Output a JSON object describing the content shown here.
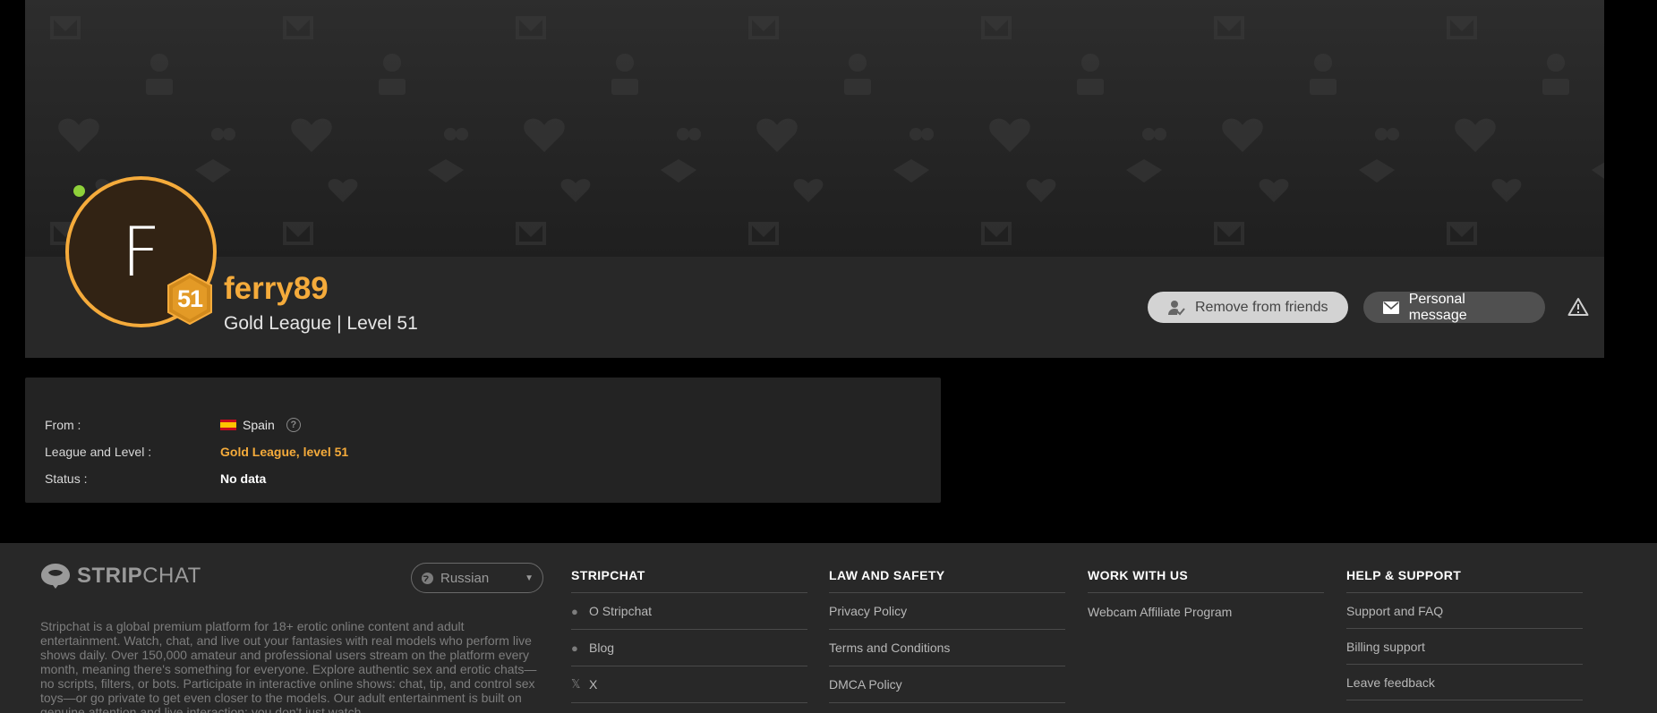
{
  "profile": {
    "avatar_letter": "F",
    "level": "51",
    "username": "ferry89",
    "league_line": "Gold League | Level 51",
    "online": true,
    "remove_friend_label": "Remove from friends",
    "message_label": "Personal message"
  },
  "info": {
    "rows": [
      {
        "label": "From :",
        "value": "Spain"
      },
      {
        "label": "League and Level :",
        "value": "Gold League, level 51"
      },
      {
        "label": "Status :",
        "value": "No data"
      }
    ]
  },
  "footer": {
    "logo_bold": "STRIP",
    "logo_light": "CHAT",
    "language": "Russian",
    "description": "Stripchat is a global premium platform for 18+ erotic online content and adult entertainment. Watch, chat, and live out your fantasies with real models who perform live shows daily. Over 150,000 amateur and professional users stream on the platform every month, meaning there's something for everyone. Explore authentic sex and erotic chats—no scripts, filters, or bots. Participate in interactive online shows: chat, tip, and control sex toys—or go private to get even closer to the models. Our adult entertainment is built on genuine attention and live interaction: you don't just watch",
    "columns": [
      {
        "title": "STRIPCHAT",
        "links": [
          {
            "label": "O Stripchat",
            "icon": "info-icon"
          },
          {
            "label": "Blog",
            "icon": "chat-bubble-icon"
          },
          {
            "label": "X",
            "icon": "x-logo-icon"
          }
        ]
      },
      {
        "title": "LAW AND SAFETY",
        "links": [
          {
            "label": "Privacy Policy"
          },
          {
            "label": "Terms and Conditions"
          },
          {
            "label": "DMCA Policy"
          }
        ]
      },
      {
        "title": "WORK WITH US",
        "links": [
          {
            "label": "Webcam Affiliate Program"
          }
        ]
      },
      {
        "title": "HELP & SUPPORT",
        "links": [
          {
            "label": "Support and FAQ"
          },
          {
            "label": "Billing support"
          },
          {
            "label": "Leave feedback"
          }
        ]
      }
    ]
  },
  "colors": {
    "accent_gold": "#f5ab3b",
    "online_green": "#8fd13a",
    "card_bg": "#282828"
  }
}
